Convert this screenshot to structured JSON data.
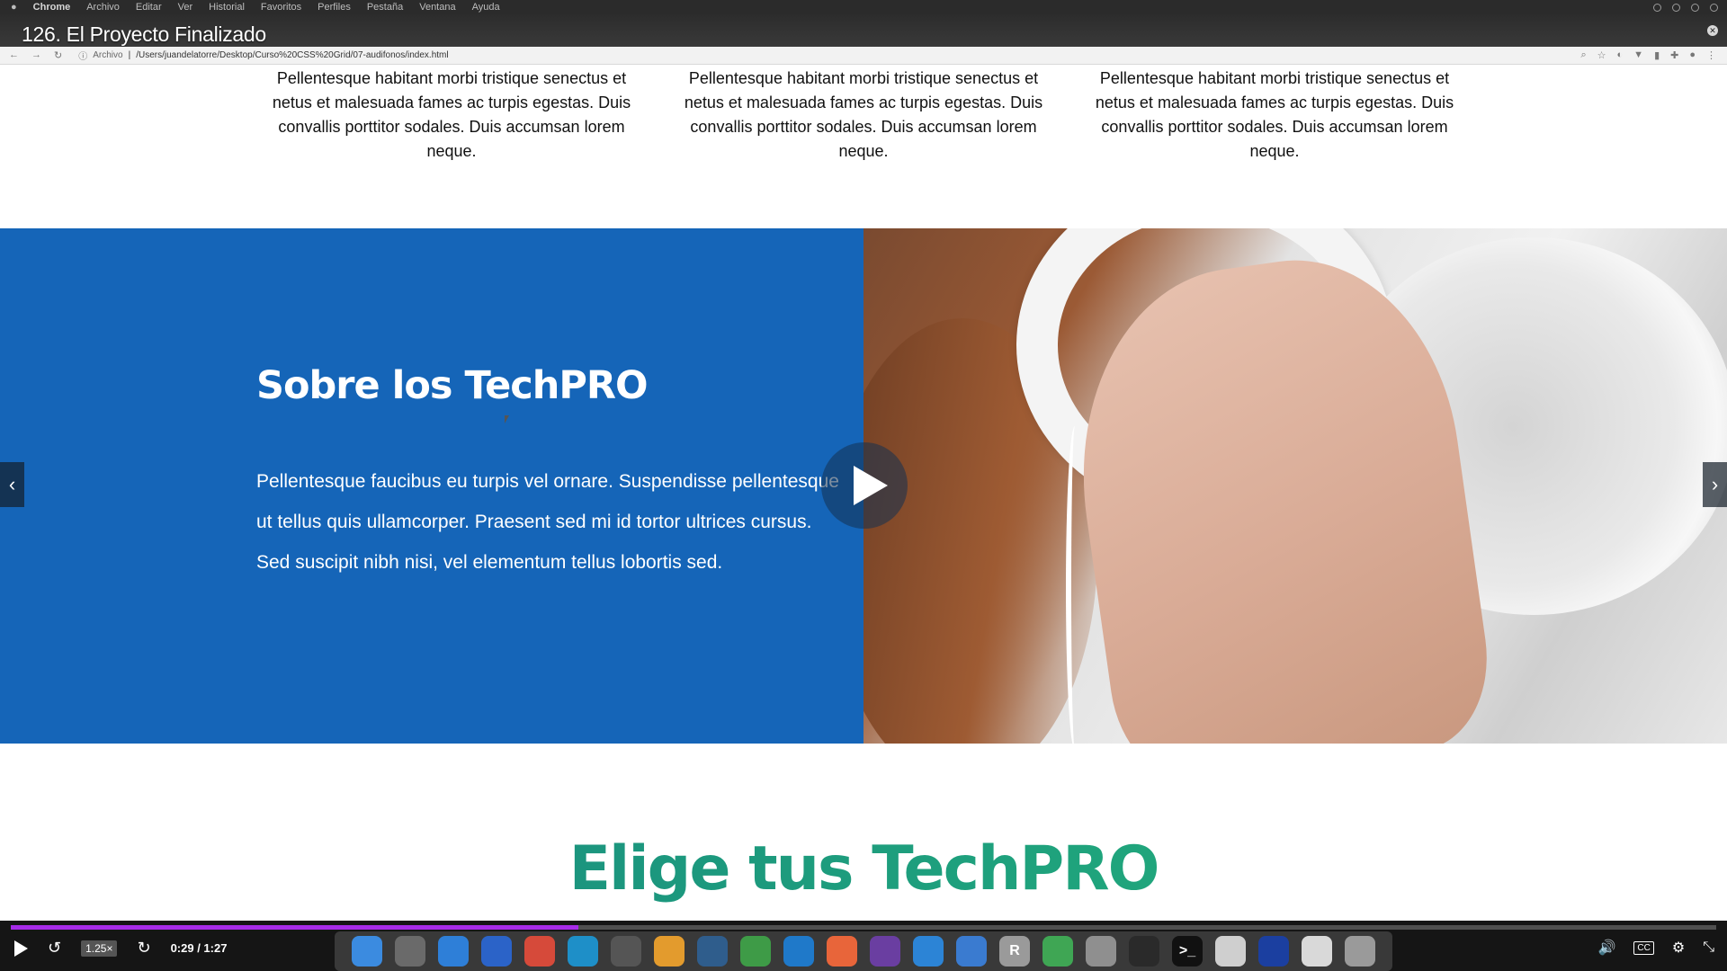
{
  "menubar": {
    "app": "Chrome",
    "items": [
      "Archivo",
      "Editar",
      "Ver",
      "Historial",
      "Favoritos",
      "Perfiles",
      "Pestaña",
      "Ventana",
      "Ayuda"
    ]
  },
  "video": {
    "title": "126. El Proyecto Finalizado",
    "speed": "1.25×",
    "time": "0:29 / 1:27",
    "progress_fraction": 0.333
  },
  "browser": {
    "secure_label": "Archivo",
    "url": "/Users/juandelatorre/Desktop/Curso%20CSS%20Grid/07-audifonos/index.html"
  },
  "features": [
    {
      "text": "Pellentesque habitant morbi tristique senectus et netus et malesuada fames ac turpis egestas. Duis convallis porttitor sodales. Duis accumsan lorem neque."
    },
    {
      "text": "Pellentesque habitant morbi tristique senectus et netus et malesuada fames ac turpis egestas. Duis convallis porttitor sodales. Duis accumsan lorem neque."
    },
    {
      "text": "Pellentesque habitant morbi tristique senectus et netus et malesuada fames ac turpis egestas. Duis convallis porttitor sodales. Duis accumsan lorem neque."
    }
  ],
  "about": {
    "title": "Sobre los TechPRO",
    "text": "Pellentesque faucibus eu turpis vel ornare. Suspendisse pellentesque ut tellus quis ullamcorper. Praesent sed mi id tortor ultrices cursus. Sed suscipit nibh nisi, vel elementum tellus lobortis sed."
  },
  "choose": {
    "title": "Elige tus TechPRO"
  },
  "colors": {
    "about_bg": "#1565b8",
    "heading_gradient_start": "#17857f",
    "heading_gradient_end": "#24b57b",
    "progress": "#a62be8"
  },
  "dock": [
    {
      "name": "finder-icon",
      "color": "#3b8be0",
      "glyph": ""
    },
    {
      "name": "launchpad-icon",
      "color": "#6a6a6a",
      "glyph": ""
    },
    {
      "name": "safari-icon",
      "color": "#2e7fd8",
      "glyph": ""
    },
    {
      "name": "firefox-icon",
      "color": "#2b63c8",
      "glyph": ""
    },
    {
      "name": "chrome-icon",
      "color": "#d64a3a",
      "glyph": ""
    },
    {
      "name": "edge-icon",
      "color": "#1e8fc8",
      "glyph": ""
    },
    {
      "name": "system-preferences-icon",
      "color": "#555",
      "glyph": ""
    },
    {
      "name": "sequel-icon",
      "color": "#e39b2d",
      "glyph": ""
    },
    {
      "name": "mysql-workbench-icon",
      "color": "#2f5d8c",
      "glyph": ""
    },
    {
      "name": "mongodb-icon",
      "color": "#3e9b47",
      "glyph": ""
    },
    {
      "name": "vscode-icon",
      "color": "#1f79c9",
      "glyph": ""
    },
    {
      "name": "postman-icon",
      "color": "#e8653a",
      "glyph": ""
    },
    {
      "name": "github-desktop-icon",
      "color": "#6a3ea1",
      "glyph": ""
    },
    {
      "name": "xcode-icon",
      "color": "#2c84d6",
      "glyph": ""
    },
    {
      "name": "simulator-icon",
      "color": "#3a7bd0",
      "glyph": ""
    },
    {
      "name": "r-icon",
      "color": "#9a9a9a",
      "glyph": "R"
    },
    {
      "name": "android-studio-icon",
      "color": "#3fa654",
      "glyph": ""
    },
    {
      "name": "sketch-icon",
      "color": "#8f8f8f",
      "glyph": ""
    },
    {
      "name": "obs-icon",
      "color": "#2a2a2a",
      "glyph": ""
    },
    {
      "name": "terminal-icon",
      "color": "#111",
      "glyph": ">_"
    },
    {
      "name": "text-editor-icon",
      "color": "#cfcfcf",
      "glyph": ""
    },
    {
      "name": "audacity-icon",
      "color": "#1b3fa0",
      "glyph": ""
    },
    {
      "name": "documents-icon",
      "color": "#d9d9d9",
      "glyph": ""
    },
    {
      "name": "trash-icon",
      "color": "#9a9a9a",
      "glyph": ""
    }
  ]
}
